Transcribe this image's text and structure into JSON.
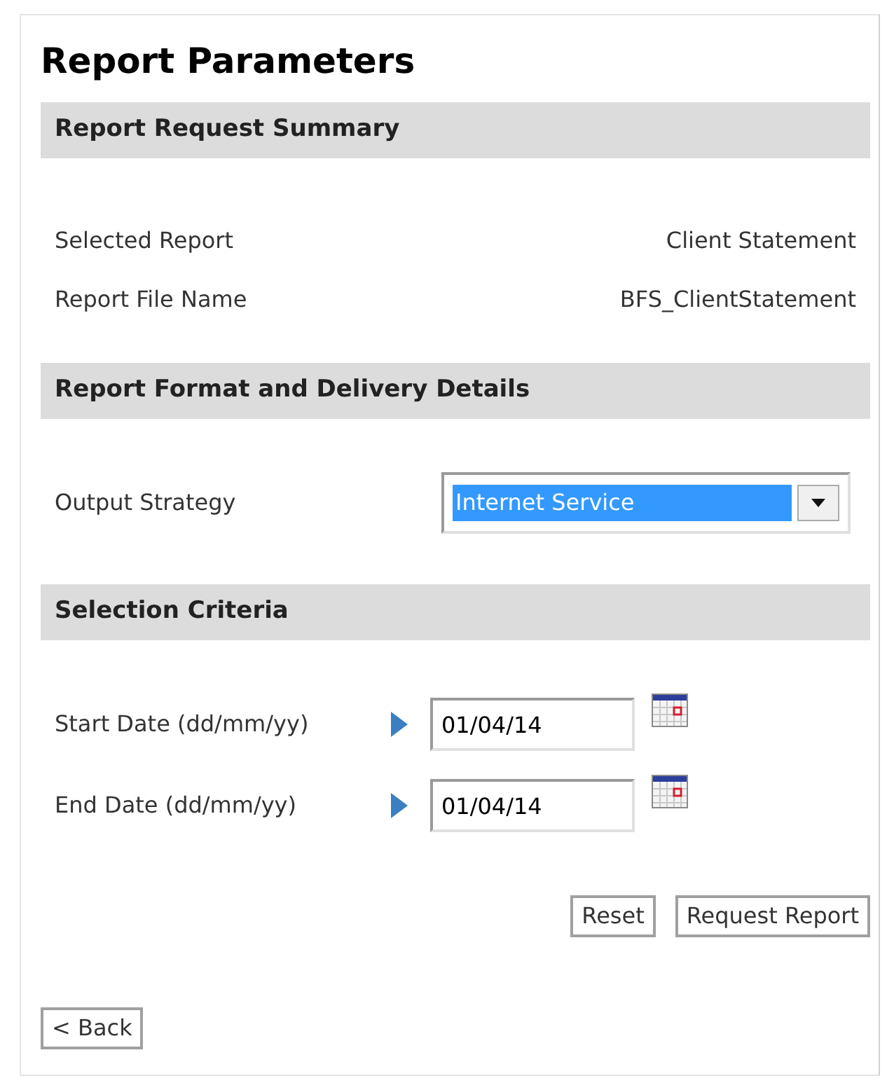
{
  "title": "Report Parameters",
  "sections": [
    {
      "heading": "Report Request Summary",
      "rows": [
        {
          "kind": "info",
          "label": "Selected Report",
          "value": "Client Statement"
        },
        {
          "kind": "info",
          "label": "Report File Name",
          "value": "BFS_ClientStatement"
        }
      ]
    },
    {
      "heading": "Report Format and Delivery Details",
      "rows": [
        {
          "kind": "select",
          "label": "Output Strategy",
          "value": "Internet Service",
          "highlighted": true
        }
      ]
    },
    {
      "heading": "Selection Criteria",
      "rows": [
        {
          "kind": "date",
          "label": "Start Date (dd/mm/yy)",
          "value": "01/04/14"
        },
        {
          "kind": "date",
          "label": "End Date (dd/mm/yy)",
          "value": "01/04/14"
        }
      ]
    }
  ],
  "buttons": [
    "Reset",
    "Request Report"
  ],
  "back_button": "< Back"
}
